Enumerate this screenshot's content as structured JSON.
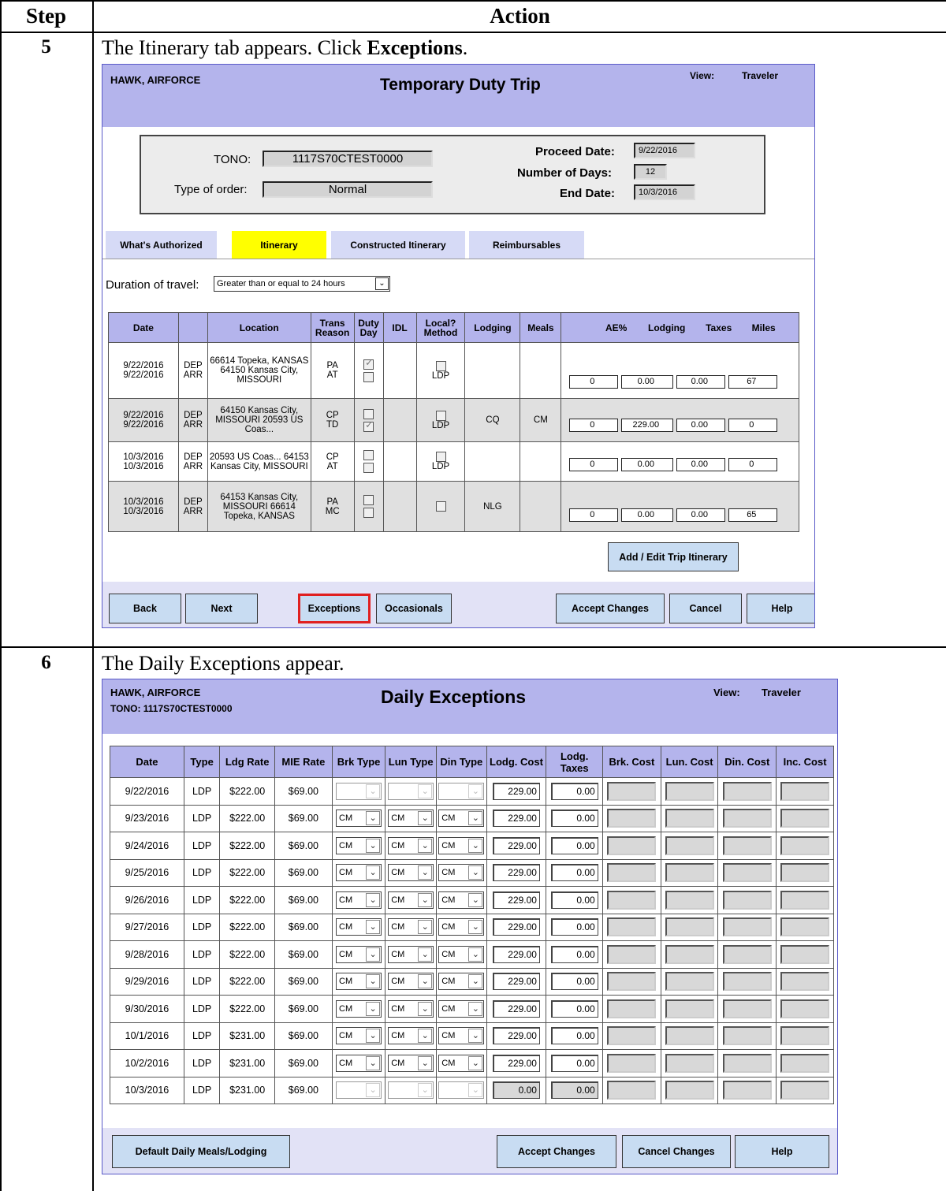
{
  "outer": {
    "step_header": "Step",
    "action_header": "Action"
  },
  "step5": {
    "number": "5",
    "text_pre": "The Itinerary tab appears. Click ",
    "text_bold": "Exceptions",
    "text_post": ".",
    "window": {
      "name": "HAWK, AIRFORCE",
      "title": "Temporary Duty Trip",
      "view_label": "View:",
      "view_value": "Traveler",
      "tono_label": "TONO:",
      "tono_value": "1117S70CTEST0000",
      "order_label": "Type of order:",
      "order_value": "Normal",
      "proceed_label": "Proceed Date:",
      "proceed_value": "9/22/2016",
      "days_label": "Number of Days:",
      "days_value": "12",
      "end_label": "End Date:",
      "end_value": "10/3/2016",
      "tabs": [
        "What's Authorized",
        "Itinerary",
        "Constructed Itinerary",
        "Reimbursables"
      ],
      "duration_label": "Duration of travel:",
      "duration_value": "Greater than or equal to 24 hours",
      "columns": [
        "Date",
        "",
        "Location",
        "Trans Reason",
        "Duty Day",
        "IDL",
        "Local? Method",
        "Lodging",
        "Meals",
        "AE%",
        "Lodging",
        "Taxes",
        "Miles"
      ],
      "rows": [
        {
          "date1": "9/22/2016",
          "date2": "9/22/2016",
          "t1": "DEP",
          "t2": "ARR",
          "loc": "66614 Topeka, KANSAS 64150 Kansas City, MISSOURI",
          "r1": "PA",
          "r2": "AT",
          "d1": true,
          "d2": false,
          "method": "LDP",
          "lodging": "",
          "meals": "",
          "ae": "0",
          "lodg": "0.00",
          "tax": "0.00",
          "miles": "67"
        },
        {
          "date1": "9/22/2016",
          "date2": "9/22/2016",
          "t1": "DEP",
          "t2": "ARR",
          "loc": "64150 Kansas City, MISSOURI 20593 US Coas...",
          "r1": "CP",
          "r2": "TD",
          "d1": false,
          "d2": true,
          "method": "LDP",
          "lodging": "CQ",
          "meals": "CM",
          "ae": "0",
          "lodg": "229.00",
          "tax": "0.00",
          "miles": "0"
        },
        {
          "date1": "10/3/2016",
          "date2": "10/3/2016",
          "t1": "DEP",
          "t2": "ARR",
          "loc": "20593 US Coas... 64153 Kansas City, MISSOURI",
          "r1": "CP",
          "r2": "AT",
          "d1": false,
          "d2": false,
          "method": "LDP",
          "lodging": "",
          "meals": "",
          "ae": "0",
          "lodg": "0.00",
          "tax": "0.00",
          "miles": "0"
        },
        {
          "date1": "10/3/2016",
          "date2": "10/3/2016",
          "t1": "DEP",
          "t2": "ARR",
          "loc": "64153 Kansas City, MISSOURI 66614 Topeka, KANSAS",
          "r1": "PA",
          "r2": "MC",
          "d1": false,
          "d2": false,
          "method": "",
          "lodging": "NLG",
          "meals": "",
          "ae": "0",
          "lodg": "0.00",
          "tax": "0.00",
          "miles": "65"
        }
      ],
      "add_edit": "Add / Edit Trip Itinerary",
      "buttons": {
        "back": "Back",
        "next": "Next",
        "exceptions": "Exceptions",
        "occasionals": "Occasionals",
        "accept": "Accept Changes",
        "cancel": "Cancel",
        "help": "Help"
      }
    }
  },
  "step6": {
    "number": "6",
    "text": "The Daily Exceptions appear.",
    "window": {
      "name": "HAWK, AIRFORCE",
      "tono": "TONO: 1117S70CTEST0000",
      "title": "Daily Exceptions",
      "view_label": "View:",
      "view_value": "Traveler",
      "columns": [
        "Date",
        "Type",
        "Ldg Rate",
        "MIE Rate",
        "Brk Type",
        "Lun Type",
        "Din Type",
        "Lodg. Cost",
        "Lodg. Taxes",
        "Brk. Cost",
        "Lun. Cost",
        "Din. Cost",
        "Inc. Cost"
      ],
      "rows": [
        {
          "date": "9/22/2016",
          "type": "LDP",
          "ldg": "$222.00",
          "mie": "$69.00",
          "meal": "",
          "cost": "229.00",
          "taxes": "0.00"
        },
        {
          "date": "9/23/2016",
          "type": "LDP",
          "ldg": "$222.00",
          "mie": "$69.00",
          "meal": "CM",
          "cost": "229.00",
          "taxes": "0.00"
        },
        {
          "date": "9/24/2016",
          "type": "LDP",
          "ldg": "$222.00",
          "mie": "$69.00",
          "meal": "CM",
          "cost": "229.00",
          "taxes": "0.00"
        },
        {
          "date": "9/25/2016",
          "type": "LDP",
          "ldg": "$222.00",
          "mie": "$69.00",
          "meal": "CM",
          "cost": "229.00",
          "taxes": "0.00"
        },
        {
          "date": "9/26/2016",
          "type": "LDP",
          "ldg": "$222.00",
          "mie": "$69.00",
          "meal": "CM",
          "cost": "229.00",
          "taxes": "0.00"
        },
        {
          "date": "9/27/2016",
          "type": "LDP",
          "ldg": "$222.00",
          "mie": "$69.00",
          "meal": "CM",
          "cost": "229.00",
          "taxes": "0.00"
        },
        {
          "date": "9/28/2016",
          "type": "LDP",
          "ldg": "$222.00",
          "mie": "$69.00",
          "meal": "CM",
          "cost": "229.00",
          "taxes": "0.00"
        },
        {
          "date": "9/29/2016",
          "type": "LDP",
          "ldg": "$222.00",
          "mie": "$69.00",
          "meal": "CM",
          "cost": "229.00",
          "taxes": "0.00"
        },
        {
          "date": "9/30/2016",
          "type": "LDP",
          "ldg": "$222.00",
          "mie": "$69.00",
          "meal": "CM",
          "cost": "229.00",
          "taxes": "0.00"
        },
        {
          "date": "10/1/2016",
          "type": "LDP",
          "ldg": "$231.00",
          "mie": "$69.00",
          "meal": "CM",
          "cost": "229.00",
          "taxes": "0.00"
        },
        {
          "date": "10/2/2016",
          "type": "LDP",
          "ldg": "$231.00",
          "mie": "$69.00",
          "meal": "CM",
          "cost": "229.00",
          "taxes": "0.00"
        },
        {
          "date": "10/3/2016",
          "type": "LDP",
          "ldg": "$231.00",
          "mie": "$69.00",
          "meal": "",
          "cost": "0.00",
          "taxes": "0.00"
        }
      ],
      "buttons": {
        "default": "Default Daily Meals/Lodging",
        "accept": "Accept Changes",
        "cancel": "Cancel Changes",
        "help": "Help"
      }
    }
  }
}
